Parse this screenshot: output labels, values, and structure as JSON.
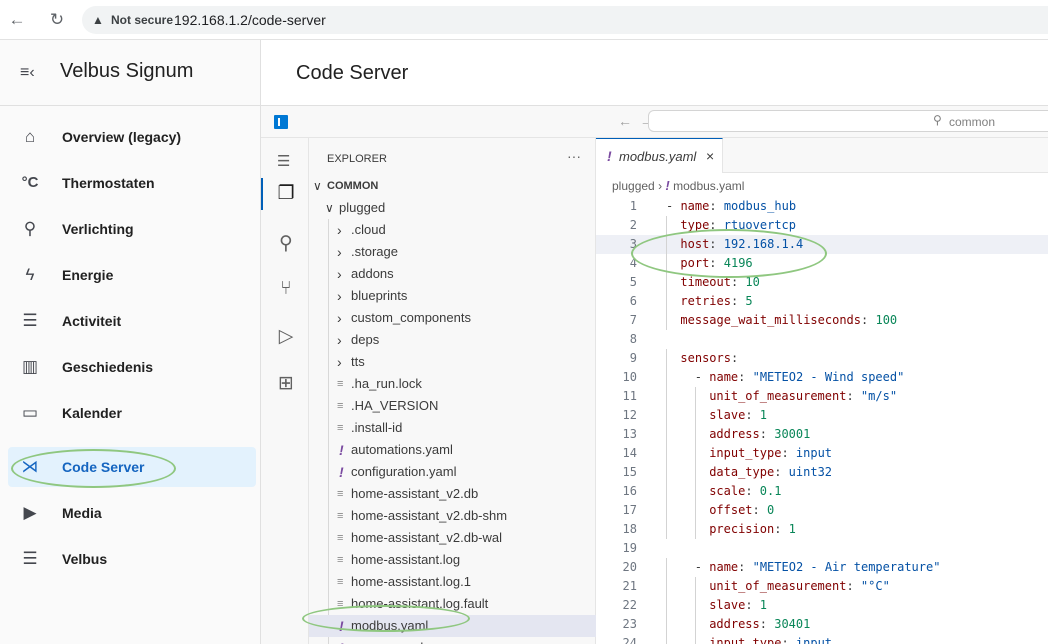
{
  "browser": {
    "back_icon": "back-arrow-icon",
    "reload_icon": "reload-icon",
    "security_label": "Not secure",
    "url": "192.168.1.2/code-server"
  },
  "sidebar": {
    "title": "Velbus Signum",
    "items": [
      {
        "label": "Overview (legacy)",
        "icon": "home-icon",
        "glyph": "⌂"
      },
      {
        "label": "Thermostaten",
        "icon": "thermometer-icon",
        "glyph": "°C"
      },
      {
        "label": "Verlichting",
        "icon": "lamp-icon",
        "glyph": "⚲"
      },
      {
        "label": "Energie",
        "icon": "lightning-icon",
        "glyph": "ϟ"
      },
      {
        "label": "Activiteit",
        "icon": "list-icon",
        "glyph": "☰"
      },
      {
        "label": "Geschiedenis",
        "icon": "chart-icon",
        "glyph": "▥"
      },
      {
        "label": "Kalender",
        "icon": "calendar-icon",
        "glyph": "▭"
      },
      {
        "label": "Code Server",
        "icon": "vscode-icon",
        "glyph": "⋊"
      },
      {
        "label": "Media",
        "icon": "media-icon",
        "glyph": "▶"
      },
      {
        "label": "Velbus",
        "icon": "list-bullets-icon",
        "glyph": "☰"
      }
    ],
    "active_color": "#1565c0"
  },
  "header": {
    "title": "Code Server"
  },
  "vscode": {
    "command_center": "common",
    "explorer_title": "EXPLORER",
    "root_folder": "COMMON",
    "subfolder": "plugged",
    "tree": [
      {
        "type": "folder",
        "name": ".cloud"
      },
      {
        "type": "folder",
        "name": ".storage"
      },
      {
        "type": "folder",
        "name": "addons"
      },
      {
        "type": "folder",
        "name": "blueprints"
      },
      {
        "type": "folder",
        "name": "custom_components"
      },
      {
        "type": "folder",
        "name": "deps"
      },
      {
        "type": "folder",
        "name": "tts"
      },
      {
        "type": "file",
        "name": ".ha_run.lock"
      },
      {
        "type": "file",
        "name": ".HA_VERSION"
      },
      {
        "type": "file",
        "name": ".install-id"
      },
      {
        "type": "yaml",
        "name": "automations.yaml"
      },
      {
        "type": "yaml",
        "name": "configuration.yaml"
      },
      {
        "type": "file",
        "name": "home-assistant_v2.db"
      },
      {
        "type": "file",
        "name": "home-assistant_v2.db-shm"
      },
      {
        "type": "file",
        "name": "home-assistant_v2.db-wal"
      },
      {
        "type": "file",
        "name": "home-assistant.log"
      },
      {
        "type": "file",
        "name": "home-assistant.log.1"
      },
      {
        "type": "file",
        "name": "home-assistant.log.fault"
      },
      {
        "type": "yaml",
        "name": "modbus.yaml",
        "selected": true
      },
      {
        "type": "yaml",
        "name": "scenes.yaml"
      }
    ],
    "tab": {
      "name": "modbus.yaml"
    },
    "breadcrumb": {
      "folder": "plugged",
      "file": "modbus.yaml"
    },
    "code": [
      {
        "n": "1",
        "indent": 0,
        "parts": [
          [
            "p",
            "- "
          ],
          [
            "k",
            "name"
          ],
          [
            "p",
            ": "
          ],
          [
            "v",
            "modbus_hub"
          ]
        ]
      },
      {
        "n": "2",
        "indent": 1,
        "parts": [
          [
            "k",
            "type"
          ],
          [
            "p",
            ": "
          ],
          [
            "v",
            "rtuovertcp"
          ]
        ]
      },
      {
        "n": "3",
        "indent": 1,
        "hl": true,
        "parts": [
          [
            "k",
            "host"
          ],
          [
            "p",
            ": "
          ],
          [
            "v",
            "192.168.1.4"
          ]
        ]
      },
      {
        "n": "4",
        "indent": 1,
        "parts": [
          [
            "k",
            "port"
          ],
          [
            "p",
            ": "
          ],
          [
            "n",
            "4196"
          ]
        ]
      },
      {
        "n": "5",
        "indent": 1,
        "parts": [
          [
            "k",
            "timeout"
          ],
          [
            "p",
            ": "
          ],
          [
            "n",
            "10"
          ]
        ]
      },
      {
        "n": "6",
        "indent": 1,
        "parts": [
          [
            "k",
            "retries"
          ],
          [
            "p",
            ": "
          ],
          [
            "n",
            "5"
          ]
        ]
      },
      {
        "n": "7",
        "indent": 1,
        "parts": [
          [
            "k",
            "message_wait_milliseconds"
          ],
          [
            "p",
            ": "
          ],
          [
            "n",
            "100"
          ]
        ]
      },
      {
        "n": "8",
        "indent": 0,
        "parts": []
      },
      {
        "n": "9",
        "indent": 1,
        "parts": [
          [
            "k",
            "sensors"
          ],
          [
            "p",
            ":"
          ]
        ]
      },
      {
        "n": "10",
        "indent": 2,
        "parts": [
          [
            "p",
            "- "
          ],
          [
            "k",
            "name"
          ],
          [
            "p",
            ": "
          ],
          [
            "v",
            "\"METEO2 - Wind speed\""
          ]
        ]
      },
      {
        "n": "11",
        "indent": 3,
        "parts": [
          [
            "k",
            "unit_of_measurement"
          ],
          [
            "p",
            ": "
          ],
          [
            "v",
            "\"m/s\""
          ]
        ]
      },
      {
        "n": "12",
        "indent": 3,
        "parts": [
          [
            "k",
            "slave"
          ],
          [
            "p",
            ": "
          ],
          [
            "n",
            "1"
          ]
        ]
      },
      {
        "n": "13",
        "indent": 3,
        "parts": [
          [
            "k",
            "address"
          ],
          [
            "p",
            ": "
          ],
          [
            "n",
            "30001"
          ]
        ]
      },
      {
        "n": "14",
        "indent": 3,
        "parts": [
          [
            "k",
            "input_type"
          ],
          [
            "p",
            ": "
          ],
          [
            "v",
            "input"
          ]
        ]
      },
      {
        "n": "15",
        "indent": 3,
        "parts": [
          [
            "k",
            "data_type"
          ],
          [
            "p",
            ": "
          ],
          [
            "v",
            "uint32"
          ]
        ]
      },
      {
        "n": "16",
        "indent": 3,
        "parts": [
          [
            "k",
            "scale"
          ],
          [
            "p",
            ": "
          ],
          [
            "n",
            "0.1"
          ]
        ]
      },
      {
        "n": "17",
        "indent": 3,
        "parts": [
          [
            "k",
            "offset"
          ],
          [
            "p",
            ": "
          ],
          [
            "n",
            "0"
          ]
        ]
      },
      {
        "n": "18",
        "indent": 3,
        "parts": [
          [
            "k",
            "precision"
          ],
          [
            "p",
            ": "
          ],
          [
            "n",
            "1"
          ]
        ]
      },
      {
        "n": "19",
        "indent": 0,
        "parts": []
      },
      {
        "n": "20",
        "indent": 2,
        "parts": [
          [
            "p",
            "- "
          ],
          [
            "k",
            "name"
          ],
          [
            "p",
            ": "
          ],
          [
            "v",
            "\"METEO2 - Air temperature\""
          ]
        ]
      },
      {
        "n": "21",
        "indent": 3,
        "parts": [
          [
            "k",
            "unit_of_measurement"
          ],
          [
            "p",
            ": "
          ],
          [
            "v",
            "\"°C\""
          ]
        ]
      },
      {
        "n": "22",
        "indent": 3,
        "parts": [
          [
            "k",
            "slave"
          ],
          [
            "p",
            ": "
          ],
          [
            "n",
            "1"
          ]
        ]
      },
      {
        "n": "23",
        "indent": 3,
        "parts": [
          [
            "k",
            "address"
          ],
          [
            "p",
            ": "
          ],
          [
            "n",
            "30401"
          ]
        ]
      },
      {
        "n": "24",
        "indent": 3,
        "parts": [
          [
            "k",
            "input_type"
          ],
          [
            "p",
            ": "
          ],
          [
            "v",
            "input"
          ]
        ]
      }
    ]
  },
  "colors": {
    "annotation": "#8fc780",
    "vscode_accent": "#005fb8"
  }
}
